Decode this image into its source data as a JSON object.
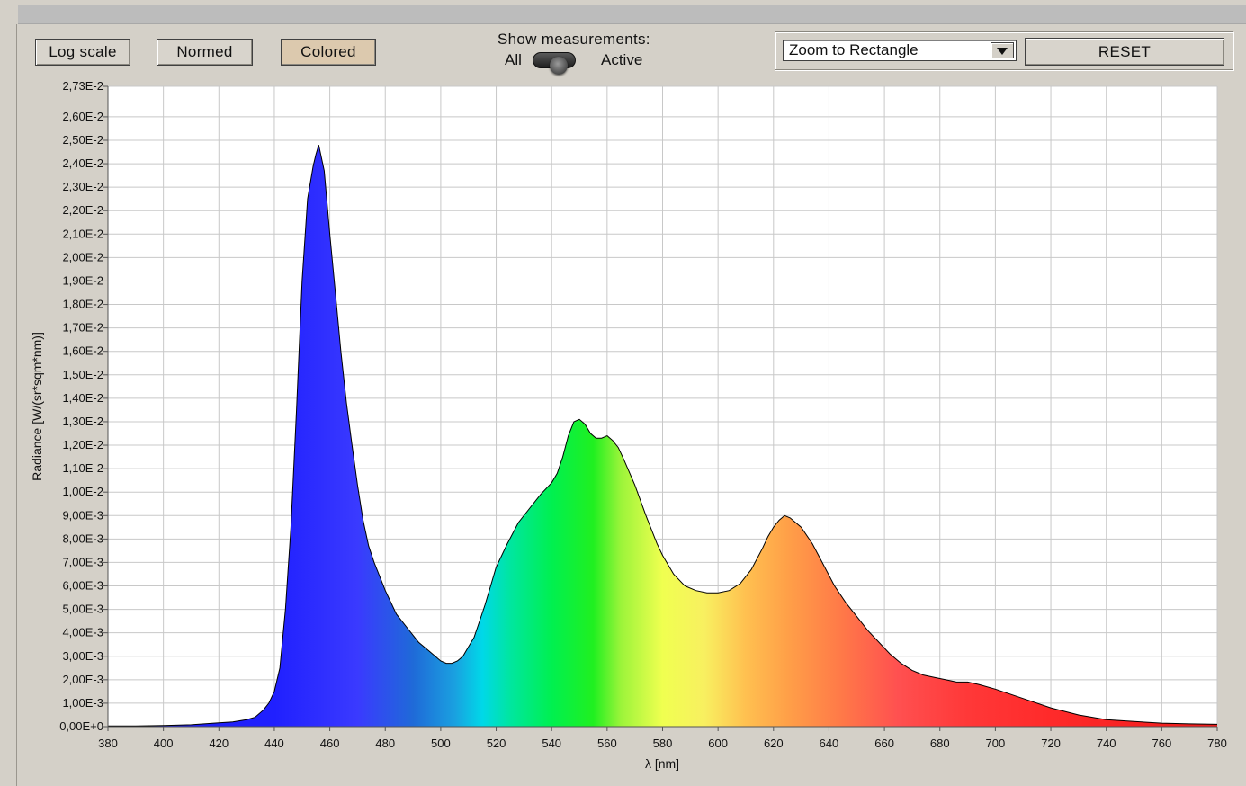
{
  "controls": {
    "log_scale": "Log scale",
    "normed": "Normed",
    "colored": "Colored",
    "show_measurements": "Show measurements:",
    "option_all": "All",
    "option_active": "Active",
    "zoom_mode": "Zoom to Rectangle",
    "reset": "RESET"
  },
  "colors": {
    "colored_button_active": "#dcc9ae",
    "plot_background": "#ffffff",
    "grid": "#c8c8c8"
  },
  "chart_data": {
    "type": "area",
    "title": "",
    "xlabel": "λ [nm]",
    "ylabel": "Radiance [W/(sr*sqm*nm)]",
    "xlim": [
      380,
      780
    ],
    "ylim": [
      0,
      0.0273
    ],
    "x_ticks": [
      380,
      400,
      420,
      440,
      460,
      480,
      500,
      520,
      540,
      560,
      580,
      600,
      620,
      640,
      660,
      680,
      700,
      720,
      740,
      760,
      780
    ],
    "y_ticks": [
      {
        "value": 0.0,
        "label": "0,00E+0"
      },
      {
        "value": 0.001,
        "label": "1,00E-3"
      },
      {
        "value": 0.002,
        "label": "2,00E-3"
      },
      {
        "value": 0.003,
        "label": "3,00E-3"
      },
      {
        "value": 0.004,
        "label": "4,00E-3"
      },
      {
        "value": 0.005,
        "label": "5,00E-3"
      },
      {
        "value": 0.006,
        "label": "6,00E-3"
      },
      {
        "value": 0.007,
        "label": "7,00E-3"
      },
      {
        "value": 0.008,
        "label": "8,00E-3"
      },
      {
        "value": 0.009,
        "label": "9,00E-3"
      },
      {
        "value": 0.01,
        "label": "1,00E-2"
      },
      {
        "value": 0.011,
        "label": "1,10E-2"
      },
      {
        "value": 0.012,
        "label": "1,20E-2"
      },
      {
        "value": 0.013,
        "label": "1,30E-2"
      },
      {
        "value": 0.014,
        "label": "1,40E-2"
      },
      {
        "value": 0.015,
        "label": "1,50E-2"
      },
      {
        "value": 0.016,
        "label": "1,60E-2"
      },
      {
        "value": 0.017,
        "label": "1,70E-2"
      },
      {
        "value": 0.018,
        "label": "1,80E-2"
      },
      {
        "value": 0.019,
        "label": "1,90E-2"
      },
      {
        "value": 0.02,
        "label": "2,00E-2"
      },
      {
        "value": 0.021,
        "label": "2,10E-2"
      },
      {
        "value": 0.022,
        "label": "2,20E-2"
      },
      {
        "value": 0.023,
        "label": "2,30E-2"
      },
      {
        "value": 0.024,
        "label": "2,40E-2"
      },
      {
        "value": 0.025,
        "label": "2,50E-2"
      },
      {
        "value": 0.026,
        "label": "2,60E-2"
      },
      {
        "value": 0.0273,
        "label": "2,73E-2"
      }
    ],
    "grid": true,
    "fill": "spectral-colored",
    "series": [
      {
        "x": [
          380,
          390,
          400,
          410,
          420,
          425,
          430,
          433,
          436,
          438,
          440,
          442,
          444,
          446,
          448,
          450,
          452,
          454,
          455,
          456,
          458,
          460,
          462,
          464,
          466,
          468,
          470,
          472,
          474,
          476,
          478,
          480,
          484,
          488,
          492,
          496,
          500,
          502,
          504,
          506,
          508,
          510,
          512,
          514,
          516,
          518,
          520,
          524,
          528,
          532,
          536,
          540,
          542,
          544,
          546,
          548,
          550,
          552,
          554,
          556,
          558,
          560,
          562,
          564,
          566,
          570,
          574,
          578,
          580,
          584,
          588,
          592,
          596,
          600,
          604,
          608,
          612,
          616,
          618,
          620,
          622,
          624,
          626,
          630,
          634,
          638,
          642,
          646,
          650,
          654,
          658,
          662,
          666,
          670,
          674,
          678,
          682,
          686,
          690,
          694,
          700,
          710,
          720,
          730,
          740,
          750,
          760,
          770,
          780
        ],
        "y": [
          3e-05,
          3e-05,
          5e-05,
          8e-05,
          0.00016,
          0.0002,
          0.0003,
          0.0004,
          0.0007,
          0.001,
          0.0015,
          0.0025,
          0.005,
          0.0085,
          0.0135,
          0.019,
          0.0225,
          0.0239,
          0.0244,
          0.0248,
          0.0237,
          0.021,
          0.0185,
          0.016,
          0.0138,
          0.012,
          0.0103,
          0.0088,
          0.0077,
          0.007,
          0.0064,
          0.0058,
          0.0048,
          0.0042,
          0.0036,
          0.0032,
          0.0028,
          0.0027,
          0.0027,
          0.0028,
          0.003,
          0.0034,
          0.0038,
          0.0045,
          0.0052,
          0.006,
          0.0068,
          0.0078,
          0.0087,
          0.0093,
          0.0099,
          0.0104,
          0.0108,
          0.0115,
          0.0124,
          0.013,
          0.0131,
          0.0129,
          0.0125,
          0.0123,
          0.0123,
          0.0124,
          0.0122,
          0.0119,
          0.0114,
          0.0103,
          0.009,
          0.0078,
          0.0073,
          0.0065,
          0.006,
          0.0058,
          0.0057,
          0.0057,
          0.0058,
          0.0061,
          0.0067,
          0.0076,
          0.0081,
          0.0085,
          0.0088,
          0.009,
          0.0089,
          0.0085,
          0.0078,
          0.0069,
          0.006,
          0.0053,
          0.0047,
          0.0041,
          0.0036,
          0.0031,
          0.0027,
          0.0024,
          0.0022,
          0.0021,
          0.002,
          0.0019,
          0.0019,
          0.0018,
          0.0016,
          0.0012,
          0.0008,
          0.0005,
          0.0003,
          0.00022,
          0.00015,
          0.00012,
          0.0001
        ]
      }
    ]
  }
}
